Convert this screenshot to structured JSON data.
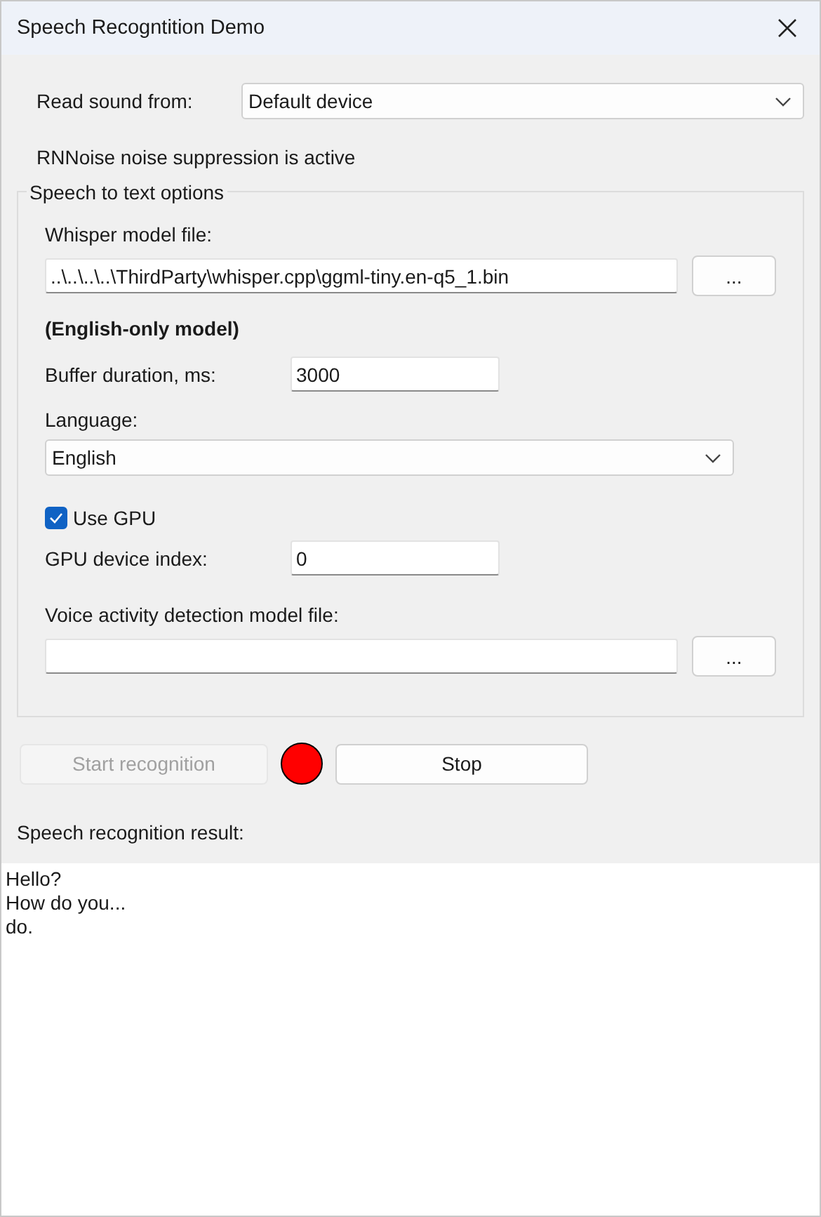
{
  "window": {
    "title": "Speech Recogntition Demo"
  },
  "source": {
    "label": "Read sound from:",
    "value": "Default device"
  },
  "noise_status": "RNNoise noise suppression is active",
  "options": {
    "title": "Speech to text options",
    "model_file": {
      "label": "Whisper model file:",
      "value": "..\\..\\..\\..\\ThirdParty\\whisper.cpp\\ggml-tiny.en-q5_1.bin",
      "browse": "..."
    },
    "model_note": "(English-only model)",
    "buffer": {
      "label": "Buffer duration, ms:",
      "value": "3000"
    },
    "language": {
      "label": "Language:",
      "value": "English"
    },
    "use_gpu": {
      "label": "Use GPU",
      "checked": true
    },
    "gpu_index": {
      "label": "GPU device index:",
      "value": "0"
    },
    "vad_file": {
      "label": "Voice activity detection model file:",
      "browse": "..."
    }
  },
  "controls": {
    "start": {
      "label": "Start recognition",
      "disabled": true
    },
    "recording": true,
    "stop": {
      "label": "Stop",
      "disabled": false
    }
  },
  "result": {
    "label": "Speech recognition result:",
    "lines": [
      "Hello?",
      "How do you...",
      "do."
    ]
  }
}
